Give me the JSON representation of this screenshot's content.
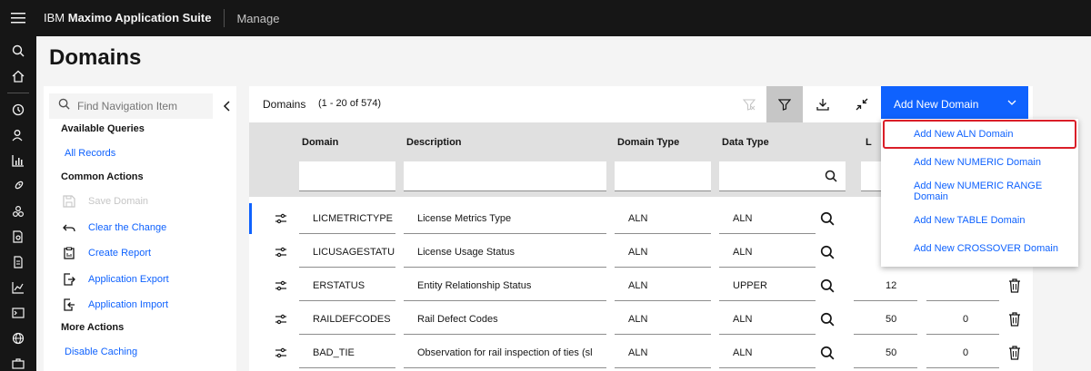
{
  "header": {
    "brand_prefix": "IBM",
    "brand_name": "Maximo Application Suite",
    "app_name": "Manage"
  },
  "page": {
    "title": "Domains"
  },
  "nav": {
    "search_placeholder": "Find Navigation Item",
    "available_queries": "Available Queries",
    "all_records": "All Records",
    "common_actions": "Common Actions",
    "actions": [
      {
        "label": "Save Domain",
        "icon": "save-icon",
        "disabled": true
      },
      {
        "label": "Clear the Change",
        "icon": "undo-icon"
      },
      {
        "label": "Create Report",
        "icon": "report-icon"
      },
      {
        "label": "Application Export",
        "icon": "export-icon"
      },
      {
        "label": "Application Import",
        "icon": "import-icon"
      }
    ],
    "more_actions": "More Actions",
    "disable_caching": "Disable Caching"
  },
  "table": {
    "title": "Domains",
    "count": "(1 - 20 of 574)",
    "add_button": "Add New Domain",
    "columns": [
      "Domain",
      "Description",
      "Domain Type",
      "Data Type",
      "L"
    ],
    "rows": [
      {
        "domain": "LICMETRICTYPE",
        "description": "License Metrics Type",
        "domain_type": "ALN",
        "data_type": "ALN",
        "length": "",
        "scale": ""
      },
      {
        "domain": "LICUSAGESTATUS",
        "description": "License Usage Status",
        "domain_type": "ALN",
        "data_type": "ALN",
        "length": "",
        "scale": ""
      },
      {
        "domain": "ERSTATUS",
        "description": "Entity Relationship Status",
        "domain_type": "ALN",
        "data_type": "UPPER",
        "length": "12",
        "scale": ""
      },
      {
        "domain": "RAILDEFCODES",
        "description": "Rail Defect Codes",
        "domain_type": "ALN",
        "data_type": "ALN",
        "length": "50",
        "scale": "0"
      },
      {
        "domain": "BAD_TIE",
        "description": "Observation for rail inspection of ties (sl",
        "domain_type": "ALN",
        "data_type": "ALN",
        "length": "50",
        "scale": "0"
      }
    ]
  },
  "dropdown": {
    "items": [
      "Add New ALN Domain",
      "Add New NUMERIC Domain",
      "Add New NUMERIC RANGE Domain",
      "Add New TABLE Domain",
      "Add New CROSSOVER Domain"
    ]
  },
  "colors": {
    "accent": "#0f62fe",
    "topbar": "#161616",
    "highlight_border": "#da1e28"
  }
}
